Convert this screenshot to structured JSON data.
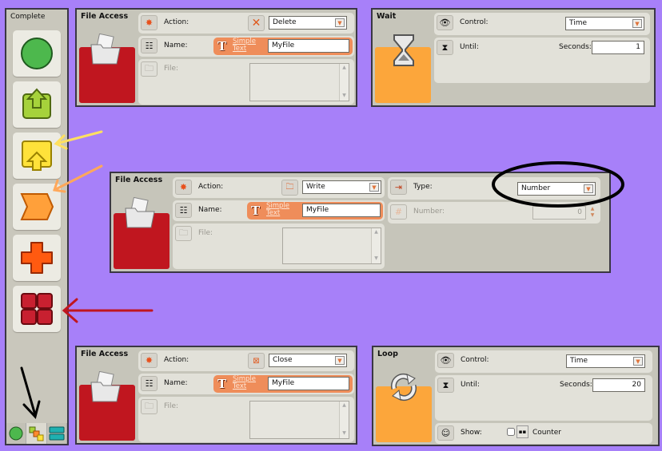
{
  "palette": {
    "title": "Complete",
    "items": [
      {
        "name": "common-blocks",
        "icon": "green-circle-icon",
        "color": "#4db84d"
      },
      {
        "name": "action-blocks",
        "icon": "green-up-arrow-icon",
        "color": "#a6d23b"
      },
      {
        "name": "sensor-blocks",
        "icon": "yellow-up-arrow-icon",
        "color": "#ffe23a"
      },
      {
        "name": "flow-blocks",
        "icon": "orange-chevron-icon",
        "color": "#ffa03a"
      },
      {
        "name": "data-blocks",
        "icon": "red-cross-icon",
        "color": "#ff5a10"
      },
      {
        "name": "advanced-blocks",
        "icon": "red-grid-icon",
        "color": "#c82030"
      }
    ],
    "tabs": [
      "common-palette",
      "complete-palette",
      "custom-palette"
    ],
    "active_tab": "complete-palette"
  },
  "blocks": {
    "file_delete": {
      "title": "File Access",
      "action_label": "Action:",
      "action_value": "Delete",
      "name_label": "Name:",
      "simple_text": "Simple Text",
      "name_value": "MyFile",
      "file_label": "File:"
    },
    "wait": {
      "title": "Wait",
      "control_label": "Control:",
      "control_value": "Time",
      "until_label": "Until:",
      "seconds_label": "Seconds:",
      "seconds_value": "1"
    },
    "file_write": {
      "title": "File Access",
      "action_label": "Action:",
      "action_value": "Write",
      "name_label": "Name:",
      "simple_text": "Simple Text",
      "name_value": "MyFile",
      "file_label": "File:",
      "type_label": "Type:",
      "type_value": "Number",
      "number_label": "Number:",
      "number_value": "0"
    },
    "file_close": {
      "title": "File Access",
      "action_label": "Action:",
      "action_value": "Close",
      "name_label": "Name:",
      "simple_text": "Simple Text",
      "name_value": "MyFile",
      "file_label": "File:"
    },
    "loop": {
      "title": "Loop",
      "control_label": "Control:",
      "control_value": "Time",
      "until_label": "Until:",
      "seconds_label": "Seconds:",
      "seconds_value": "20",
      "show_label": "Show:",
      "counter_label": "Counter",
      "counter_checked": false
    }
  },
  "colors": {
    "background": "#a780f9",
    "file_block": "#c0161f",
    "flow_block": "#fca63b",
    "simple_text": "#ef8d5a"
  }
}
